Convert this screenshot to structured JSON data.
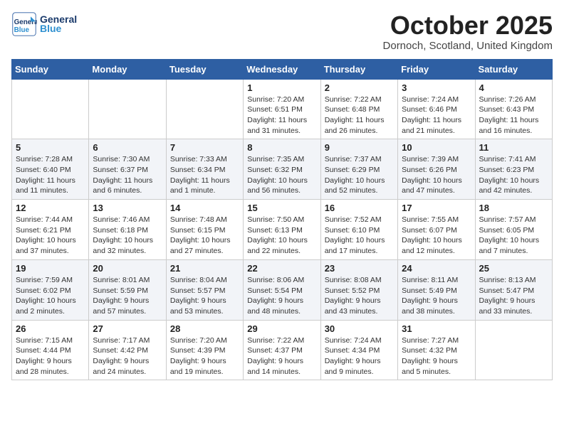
{
  "header": {
    "logo_line1": "General",
    "logo_line2": "Blue",
    "month": "October 2025",
    "location": "Dornoch, Scotland, United Kingdom"
  },
  "days_of_week": [
    "Sunday",
    "Monday",
    "Tuesday",
    "Wednesday",
    "Thursday",
    "Friday",
    "Saturday"
  ],
  "weeks": [
    [
      {
        "day": "",
        "info": ""
      },
      {
        "day": "",
        "info": ""
      },
      {
        "day": "",
        "info": ""
      },
      {
        "day": "1",
        "info": "Sunrise: 7:20 AM\nSunset: 6:51 PM\nDaylight: 11 hours\nand 31 minutes."
      },
      {
        "day": "2",
        "info": "Sunrise: 7:22 AM\nSunset: 6:48 PM\nDaylight: 11 hours\nand 26 minutes."
      },
      {
        "day": "3",
        "info": "Sunrise: 7:24 AM\nSunset: 6:46 PM\nDaylight: 11 hours\nand 21 minutes."
      },
      {
        "day": "4",
        "info": "Sunrise: 7:26 AM\nSunset: 6:43 PM\nDaylight: 11 hours\nand 16 minutes."
      }
    ],
    [
      {
        "day": "5",
        "info": "Sunrise: 7:28 AM\nSunset: 6:40 PM\nDaylight: 11 hours\nand 11 minutes."
      },
      {
        "day": "6",
        "info": "Sunrise: 7:30 AM\nSunset: 6:37 PM\nDaylight: 11 hours\nand 6 minutes."
      },
      {
        "day": "7",
        "info": "Sunrise: 7:33 AM\nSunset: 6:34 PM\nDaylight: 11 hours\nand 1 minute."
      },
      {
        "day": "8",
        "info": "Sunrise: 7:35 AM\nSunset: 6:32 PM\nDaylight: 10 hours\nand 56 minutes."
      },
      {
        "day": "9",
        "info": "Sunrise: 7:37 AM\nSunset: 6:29 PM\nDaylight: 10 hours\nand 52 minutes."
      },
      {
        "day": "10",
        "info": "Sunrise: 7:39 AM\nSunset: 6:26 PM\nDaylight: 10 hours\nand 47 minutes."
      },
      {
        "day": "11",
        "info": "Sunrise: 7:41 AM\nSunset: 6:23 PM\nDaylight: 10 hours\nand 42 minutes."
      }
    ],
    [
      {
        "day": "12",
        "info": "Sunrise: 7:44 AM\nSunset: 6:21 PM\nDaylight: 10 hours\nand 37 minutes."
      },
      {
        "day": "13",
        "info": "Sunrise: 7:46 AM\nSunset: 6:18 PM\nDaylight: 10 hours\nand 32 minutes."
      },
      {
        "day": "14",
        "info": "Sunrise: 7:48 AM\nSunset: 6:15 PM\nDaylight: 10 hours\nand 27 minutes."
      },
      {
        "day": "15",
        "info": "Sunrise: 7:50 AM\nSunset: 6:13 PM\nDaylight: 10 hours\nand 22 minutes."
      },
      {
        "day": "16",
        "info": "Sunrise: 7:52 AM\nSunset: 6:10 PM\nDaylight: 10 hours\nand 17 minutes."
      },
      {
        "day": "17",
        "info": "Sunrise: 7:55 AM\nSunset: 6:07 PM\nDaylight: 10 hours\nand 12 minutes."
      },
      {
        "day": "18",
        "info": "Sunrise: 7:57 AM\nSunset: 6:05 PM\nDaylight: 10 hours\nand 7 minutes."
      }
    ],
    [
      {
        "day": "19",
        "info": "Sunrise: 7:59 AM\nSunset: 6:02 PM\nDaylight: 10 hours\nand 2 minutes."
      },
      {
        "day": "20",
        "info": "Sunrise: 8:01 AM\nSunset: 5:59 PM\nDaylight: 9 hours\nand 57 minutes."
      },
      {
        "day": "21",
        "info": "Sunrise: 8:04 AM\nSunset: 5:57 PM\nDaylight: 9 hours\nand 53 minutes."
      },
      {
        "day": "22",
        "info": "Sunrise: 8:06 AM\nSunset: 5:54 PM\nDaylight: 9 hours\nand 48 minutes."
      },
      {
        "day": "23",
        "info": "Sunrise: 8:08 AM\nSunset: 5:52 PM\nDaylight: 9 hours\nand 43 minutes."
      },
      {
        "day": "24",
        "info": "Sunrise: 8:11 AM\nSunset: 5:49 PM\nDaylight: 9 hours\nand 38 minutes."
      },
      {
        "day": "25",
        "info": "Sunrise: 8:13 AM\nSunset: 5:47 PM\nDaylight: 9 hours\nand 33 minutes."
      }
    ],
    [
      {
        "day": "26",
        "info": "Sunrise: 7:15 AM\nSunset: 4:44 PM\nDaylight: 9 hours\nand 28 minutes."
      },
      {
        "day": "27",
        "info": "Sunrise: 7:17 AM\nSunset: 4:42 PM\nDaylight: 9 hours\nand 24 minutes."
      },
      {
        "day": "28",
        "info": "Sunrise: 7:20 AM\nSunset: 4:39 PM\nDaylight: 9 hours\nand 19 minutes."
      },
      {
        "day": "29",
        "info": "Sunrise: 7:22 AM\nSunset: 4:37 PM\nDaylight: 9 hours\nand 14 minutes."
      },
      {
        "day": "30",
        "info": "Sunrise: 7:24 AM\nSunset: 4:34 PM\nDaylight: 9 hours\nand 9 minutes."
      },
      {
        "day": "31",
        "info": "Sunrise: 7:27 AM\nSunset: 4:32 PM\nDaylight: 9 hours\nand 5 minutes."
      },
      {
        "day": "",
        "info": ""
      }
    ]
  ]
}
